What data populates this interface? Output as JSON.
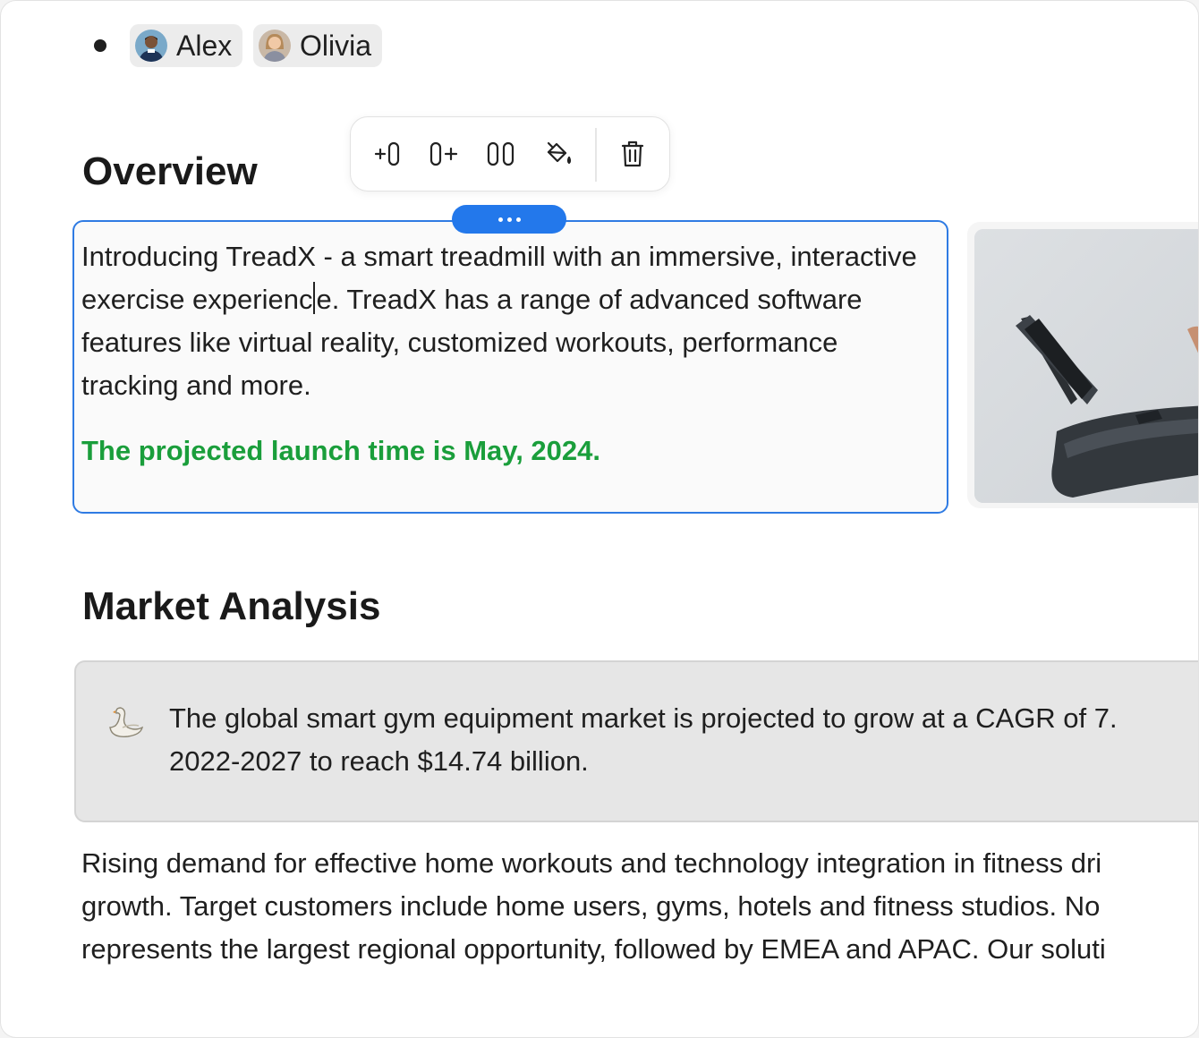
{
  "mentions": [
    {
      "name": "Alex",
      "avatar_icon": "person-avatar-icon"
    },
    {
      "name": "Olivia",
      "avatar_icon": "person-avatar-icon"
    }
  ],
  "overview": {
    "heading": "Overview",
    "paragraph_before_caret": "Introducing TreadX - a smart treadmill with an immersive, interactive exercise experienc",
    "paragraph_after_caret": "e. TreadX has a range of advanced software features like virtual reality, customized workouts, performance tracking and more.",
    "launch_note": "The projected launch time is May, 2024.",
    "launch_color": "#1a9e3b"
  },
  "toolbar": {
    "buttons": [
      "insert-column-left-icon",
      "insert-column-right-icon",
      "split-columns-icon",
      "paint-bucket-icon",
      "trash-icon"
    ]
  },
  "selection_accent": "#2f7be3",
  "market": {
    "heading": "Market Analysis",
    "callout_icon": "swan-emoji-icon",
    "callout_line1": "The global smart gym equipment market is projected to grow at a CAGR of 7.",
    "callout_line2": "2022-2027 to reach $14.74 billion.",
    "body_line1": "Rising demand for effective home workouts and technology integration in fitness dri",
    "body_line2": "growth. Target customers include home users, gyms, hotels and fitness studios. No",
    "body_line3": "represents the largest regional opportunity, followed by EMEA and APAC. Our soluti"
  }
}
